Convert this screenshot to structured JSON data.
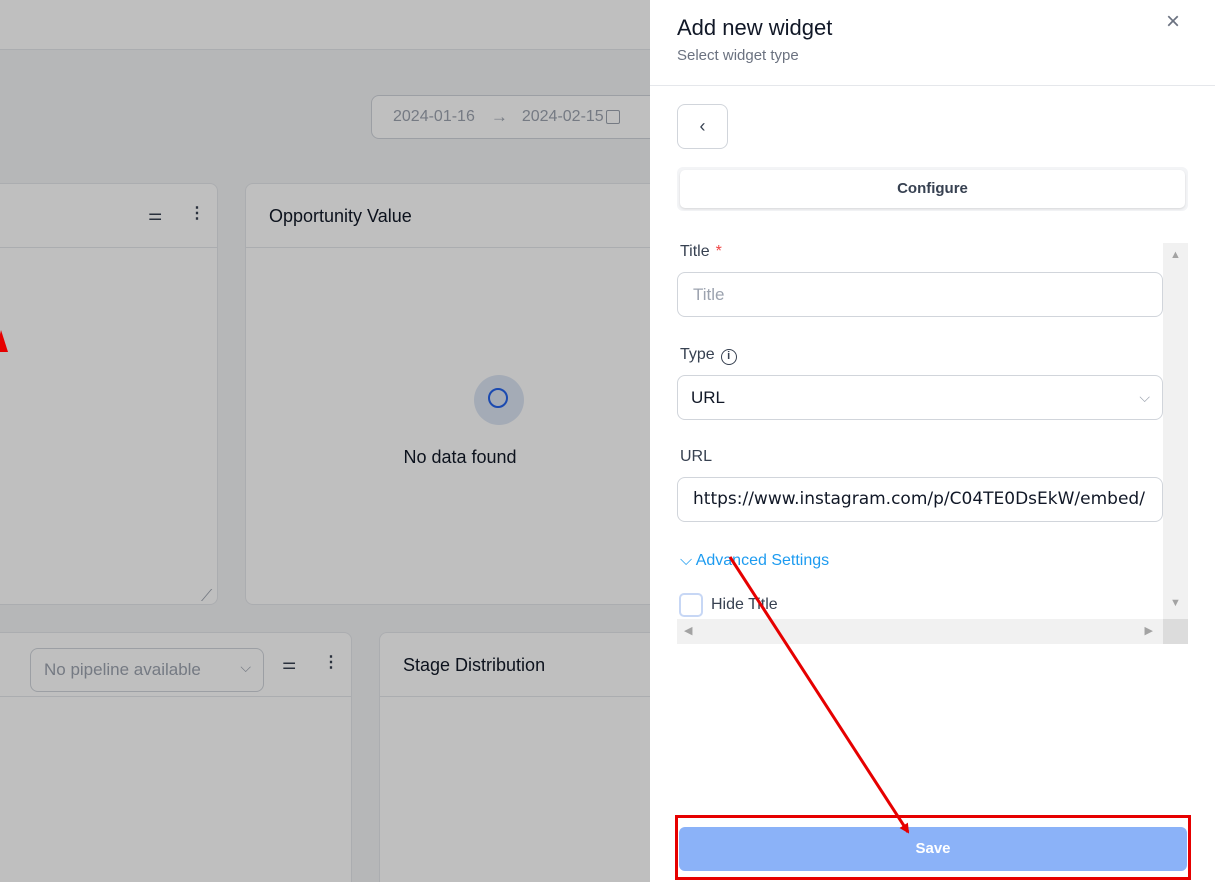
{
  "dashboard": {
    "date_start": "2024-01-16",
    "date_arrow": "→",
    "date_end": "2024-02-15",
    "card2_title": "Opportunity Value",
    "no_data_text": "No data found",
    "pipeline_placeholder": "No pipeline available",
    "card4_title": "Stage Distribution"
  },
  "drawer": {
    "title": "Add new widget",
    "subtitle": "Select widget type",
    "close_icon": "×",
    "back_icon": "‹",
    "tab_label": "Configure",
    "title_label": "Title",
    "required_mark": "*",
    "title_placeholder": "Title",
    "type_label": "Type",
    "info_icon": "i",
    "type_value": "URL",
    "url_label": "URL",
    "url_value": "https://www.instagram.com/p/C04TE0DsEkW/embed/",
    "advanced_label": "Advanced Settings",
    "hide_title_label": "Hide Title",
    "save_label": "Save"
  },
  "colors": {
    "accent": "#1d9bf0",
    "save_button": "#8bb2f8",
    "annotation": "#e60000"
  }
}
